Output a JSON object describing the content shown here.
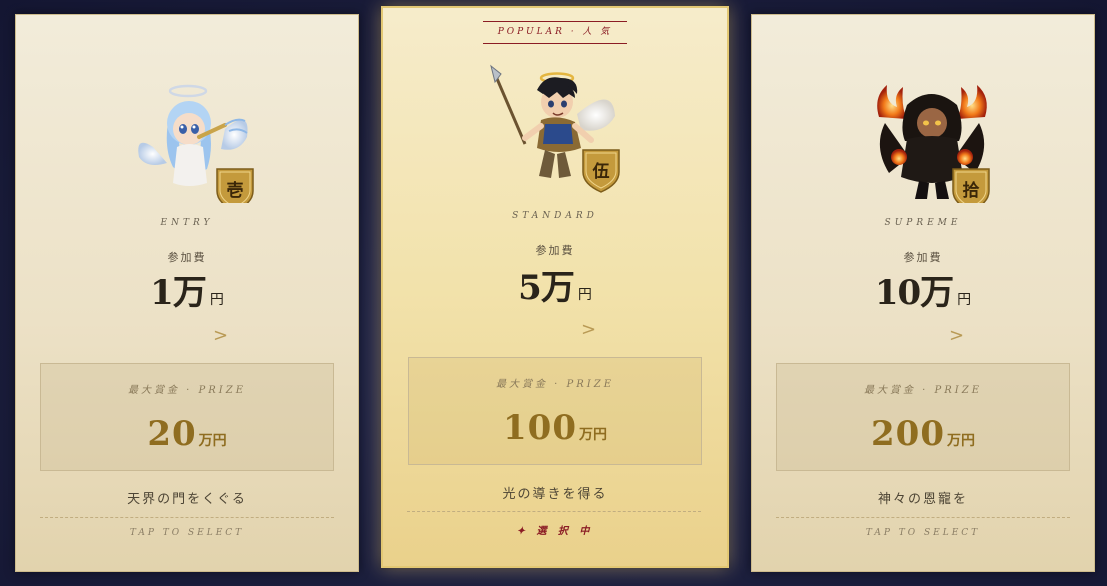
{
  "popular_badge": "POPULAR · 人 気",
  "colors": {
    "background": "#1b1e3c",
    "accent_gold": "#8f6d20",
    "popular_red": "#8b1c24"
  },
  "cards": [
    {
      "tier": "ENTRY",
      "kanji": "壱",
      "character_icon": "angel-cherub-icon",
      "fee_label": "参加費",
      "fee_amount": "1万",
      "fee_unit": "円",
      "arrow": ">",
      "prize_label": "最大賞金 · PRIZE",
      "prize_amount": "20",
      "prize_unit": "万円",
      "motto": "天界の門をくぐる",
      "action": "TAP TO SELECT"
    },
    {
      "tier": "STANDARD",
      "kanji": "伍",
      "character_icon": "angel-warrior-icon",
      "fee_label": "参加費",
      "fee_amount": "5万",
      "fee_unit": "円",
      "arrow": ">",
      "prize_label": "最大賞金 · PRIZE",
      "prize_amount": "100",
      "prize_unit": "万円",
      "motto": "光の導きを得る",
      "action": "✦ 選 択 中"
    },
    {
      "tier": "SUPREME",
      "kanji": "拾",
      "character_icon": "dark-flame-warrior-icon",
      "fee_label": "参加費",
      "fee_amount": "10万",
      "fee_unit": "円",
      "arrow": ">",
      "prize_label": "最大賞金 · PRIZE",
      "prize_amount": "200",
      "prize_unit": "万円",
      "motto": "神々の恩寵を",
      "action": "TAP TO SELECT"
    }
  ]
}
